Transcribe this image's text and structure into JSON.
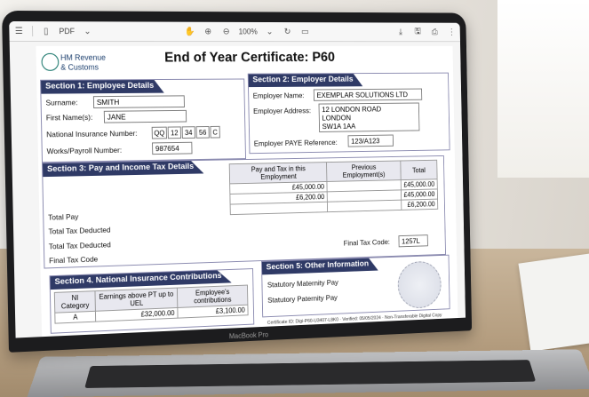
{
  "viewer": {
    "format_label": "PDF",
    "zoom": "100%"
  },
  "logo": {
    "line1": "HM Revenue",
    "line2": "& Customs"
  },
  "doc_title": "End of Year Certificate: P60",
  "section1": {
    "heading": "Section 1: Employee Details",
    "surname_label": "Surname:",
    "surname": "SMITH",
    "first_label": "First Name(s):",
    "first": "JANE",
    "ni_label": "National Insurance Number:",
    "ni_parts": [
      "QQ",
      "12",
      "34",
      "56",
      "C"
    ],
    "works_label": "Works/Payroll Number:",
    "works": "987654"
  },
  "section2": {
    "heading": "Section 2: Employer Details",
    "name_label": "Employer Name:",
    "name": "EXEMPLAR SOLUTIONS LTD",
    "address_label": "Employer Address:",
    "address_lines": [
      "12 LONDON ROAD",
      "LONDON",
      "SW1A 1AA"
    ],
    "paye_label": "Employer PAYE Reference:",
    "paye": "123/A123"
  },
  "section3": {
    "heading": "Section 3: Pay and Income Tax Details",
    "col_headers": [
      "Pay and Tax in this Employment",
      "Previous Employment(s)",
      "Total"
    ],
    "rows": [
      {
        "label": "Total Pay",
        "current": "£45,000.00",
        "previous": "",
        "total": "£45,000.00"
      },
      {
        "label": "Total Tax Deducted",
        "current": "£6,200.00",
        "previous": "",
        "total": "£45,000.00"
      },
      {
        "label": "Total Tax Deducted",
        "current": "",
        "previous": "",
        "total": "£6,200.00"
      },
      {
        "label": "Final Tax Code",
        "current": "",
        "previous": "",
        "total": ""
      }
    ],
    "final_code_label": "Final Tax Code:",
    "final_code": "1257L"
  },
  "section4": {
    "heading": "Section 4. National Insurance Contributions",
    "col_headers": [
      "NI Category",
      "Earnings above PT up to UEL",
      "Employee's contributions"
    ],
    "row": {
      "category": "A",
      "earnings": "£32,000.00",
      "contributions": "£3,100.00"
    }
  },
  "section5": {
    "heading": "Section 5: Other Information",
    "items": [
      "Statutory Maternity Pay",
      "Statutory Paternity Pay"
    ]
  },
  "footer": "Certificate ID: Digi-P60-U3407-L8K0 · Verified: 05/05/2024 · Non-Transferable Digital Copy",
  "laptop_brand": "MacBook Pro"
}
